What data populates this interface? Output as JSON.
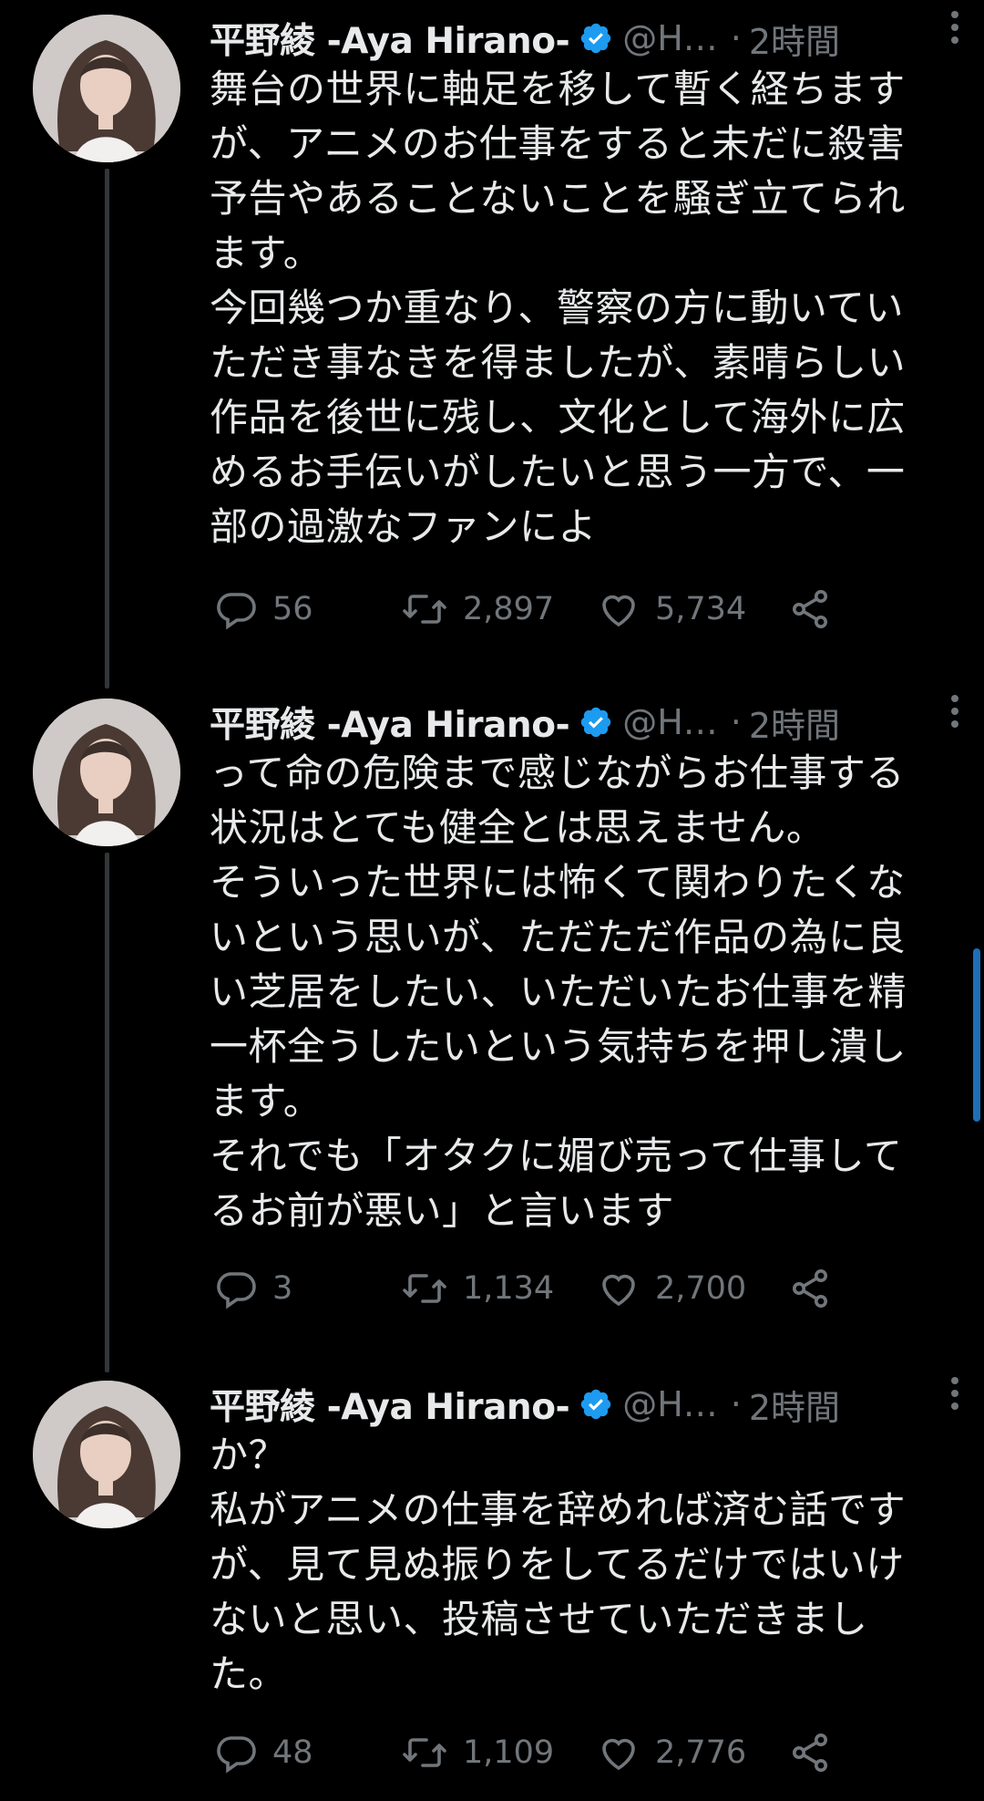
{
  "colors": {
    "background": "#000000",
    "text": "#e7e9ea",
    "muted": "#71767b",
    "verified": "#1d9bf0",
    "thread_line": "#333639"
  },
  "tweets": [
    {
      "author": "平野綾 -Aya Hirano-",
      "handle": "@H…",
      "dot": "·",
      "time": "2時間",
      "text": "舞台の世界に軸足を移して暫く経ちます\nが、アニメのお仕事をすると未だに殺害\n予告やあることないことを騒ぎ立てられ\nます。\n今回幾つか重なり、警察の方に動いてい\nただき事なきを得ましたが、素晴らしい\n作品を後世に残し、文化として海外に広\nめるお手伝いがしたいと思う一方で、一\n部の過激なファンによ",
      "replies": "56",
      "retweets": "2,897",
      "likes": "5,734"
    },
    {
      "author": "平野綾 -Aya Hirano-",
      "handle": "@H…",
      "dot": "·",
      "time": "2時間",
      "text": "って命の危険まで感じながらお仕事する\n状況はとても健全とは思えません。\nそういった世界には怖くて関わりたくな\nいという思いが、ただただ作品の為に良\nい芝居をしたい、いただいたお仕事を精\n一杯全うしたいという気持ちを押し潰し\nます。\nそれでも「オタクに媚び売って仕事して\nるお前が悪い」と言います",
      "replies": "3",
      "retweets": "1,134",
      "likes": "2,700"
    },
    {
      "author": "平野綾 -Aya Hirano-",
      "handle": "@H…",
      "dot": "·",
      "time": "2時間",
      "text": "か？\n私がアニメの仕事を辞めれば済む話です\nが、見て見ぬ振りをしてるだけではいけ\nないと思い、投稿させていただきまし\nた。",
      "replies": "48",
      "retweets": "1,109",
      "likes": "2,776"
    }
  ],
  "icons": {
    "reply": "reply-icon",
    "retweet": "retweet-icon",
    "like": "heart-icon",
    "share": "share-icon",
    "verified": "verified-badge-icon",
    "more": "more-vertical-icon"
  }
}
